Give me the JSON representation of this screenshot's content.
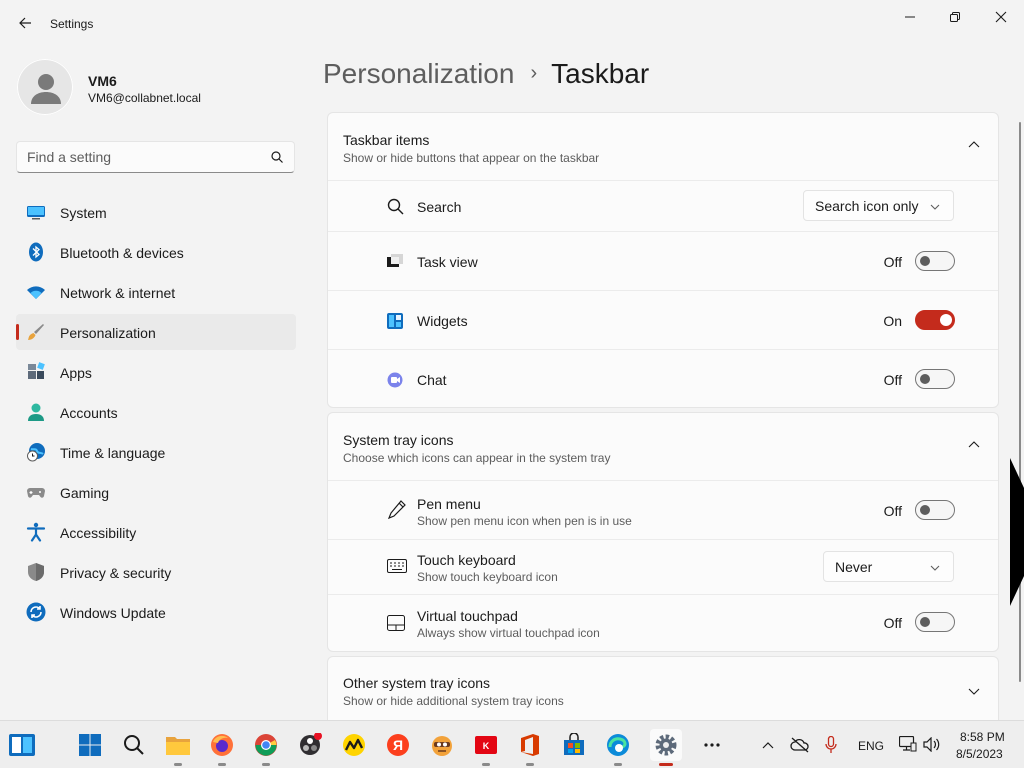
{
  "window": {
    "title": "Settings"
  },
  "user": {
    "name": "VM6",
    "email": "VM6@collabnet.local"
  },
  "search": {
    "placeholder": "Find a setting"
  },
  "sidebar": {
    "items": [
      {
        "label": "System",
        "icon": "monitor-icon"
      },
      {
        "label": "Bluetooth & devices",
        "icon": "bluetooth-icon"
      },
      {
        "label": "Network & internet",
        "icon": "wifi-icon"
      },
      {
        "label": "Personalization",
        "icon": "brush-icon",
        "active": true
      },
      {
        "label": "Apps",
        "icon": "apps-icon"
      },
      {
        "label": "Accounts",
        "icon": "person-icon"
      },
      {
        "label": "Time & language",
        "icon": "globe-clock-icon"
      },
      {
        "label": "Gaming",
        "icon": "gamepad-icon"
      },
      {
        "label": "Accessibility",
        "icon": "accessibility-icon"
      },
      {
        "label": "Privacy & security",
        "icon": "shield-icon"
      },
      {
        "label": "Windows Update",
        "icon": "update-icon"
      }
    ]
  },
  "breadcrumb": {
    "parent": "Personalization",
    "separator": "›",
    "current": "Taskbar"
  },
  "taskbar_items": {
    "title": "Taskbar items",
    "subtitle": "Show or hide buttons that appear on the taskbar",
    "rows": {
      "search": {
        "label": "Search",
        "value": "Search icon only"
      },
      "task_view": {
        "label": "Task view",
        "state": "Off"
      },
      "widgets": {
        "label": "Widgets",
        "state": "On"
      },
      "chat": {
        "label": "Chat",
        "state": "Off"
      }
    }
  },
  "system_tray": {
    "title": "System tray icons",
    "subtitle": "Choose which icons can appear in the system tray",
    "rows": {
      "pen": {
        "label": "Pen menu",
        "sub": "Show pen menu icon when pen is in use",
        "state": "Off"
      },
      "touch_keyboard": {
        "label": "Touch keyboard",
        "sub": "Show touch keyboard icon",
        "value": "Never"
      },
      "touchpad": {
        "label": "Virtual touchpad",
        "sub": "Always show virtual touchpad icon",
        "state": "Off"
      }
    }
  },
  "other_tray": {
    "title": "Other system tray icons",
    "subtitle": "Show or hide additional system tray icons"
  },
  "tray": {
    "language": "ENG",
    "time": "8:58 PM",
    "date": "8/5/2023"
  },
  "colors": {
    "accent": "#c42b1c",
    "background": "#f3f3f3",
    "card": "#fbfbfb"
  }
}
